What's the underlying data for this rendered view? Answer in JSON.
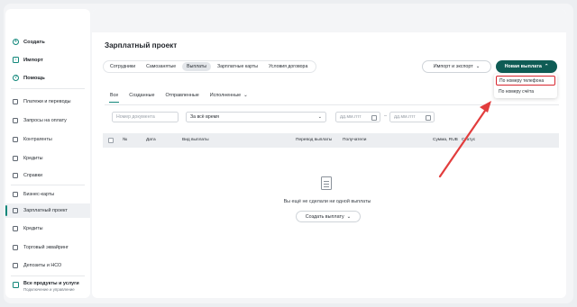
{
  "sidebar": {
    "top_items": [
      {
        "label": "Создать",
        "icon": "plus-circle-icon"
      },
      {
        "label": "Импорт",
        "icon": "import-icon"
      },
      {
        "label": "Помощь",
        "icon": "help-icon"
      }
    ],
    "items": [
      {
        "label": "Платежи и переводы",
        "icon": "payments-icon"
      },
      {
        "label": "Запросы на оплату",
        "icon": "request-icon"
      },
      {
        "label": "Контрагенты",
        "icon": "contacts-icon"
      },
      {
        "label": "Кредиты",
        "icon": "credit-icon"
      },
      {
        "label": "Справки",
        "icon": "documents-icon"
      },
      {
        "label": "Бизнес-карты",
        "icon": "card-icon"
      },
      {
        "label": "Зарплатный проект",
        "icon": "salary-icon",
        "active": true
      },
      {
        "label": "Кредиты",
        "icon": "credit-icon"
      },
      {
        "label": "Торговый эквайринг",
        "icon": "acquiring-icon"
      },
      {
        "label": "Депозиты и НСО",
        "icon": "deposit-icon"
      }
    ],
    "bottom": {
      "title": "Все продукты и услуги",
      "subtitle": "Подключение и управление",
      "icon": "products-icon"
    }
  },
  "main": {
    "title": "Зарплатный проект",
    "tabs": [
      "Сотрудники",
      "Самозанятые",
      "Выплаты",
      "Зарплатные карты",
      "Условия договора"
    ],
    "active_tab": "Выплаты",
    "import_button": "Импорт и экспорт",
    "new_button": "Новая выплата",
    "dropdown": [
      "По номеру телефона",
      "По номеру счёта"
    ],
    "subtabs": [
      "Все",
      "Созданные",
      "Отправленные",
      "Исполненные"
    ],
    "filters": {
      "doc_number_placeholder": "Номер документа",
      "period": "За всё время",
      "date_from_placeholder": "дд.мм.гггг",
      "date_to_placeholder": "дд.мм.гггг",
      "dash": "–"
    },
    "table_headers": [
      "№",
      "Дата",
      "Вид выплаты",
      "Перевод выплаты",
      "Получатели",
      "Сумма, RUB",
      "Статус"
    ],
    "empty_text": "Вы ещё не сделали ни одной выплаты",
    "create_button": "Создать выплату"
  },
  "colors": {
    "accent": "#11877a",
    "primary_button": "#0f5c55",
    "annotation_red": "#d7262e"
  }
}
